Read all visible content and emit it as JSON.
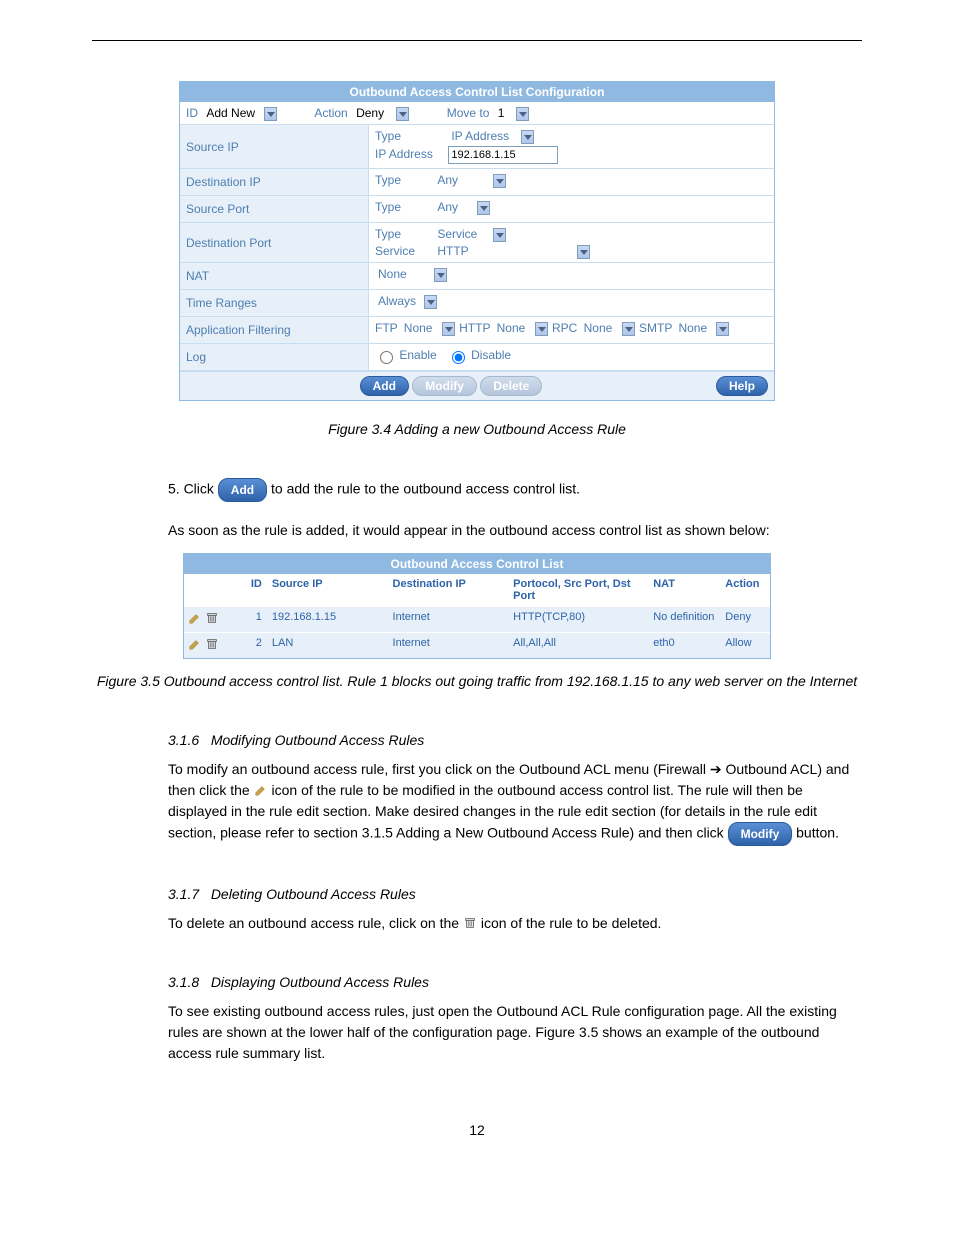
{
  "config_panel": {
    "title": "Outbound Access Control List Configuration",
    "id_label": "ID",
    "id_value": "Add New",
    "action_label": "Action",
    "action_value": "Deny",
    "moveto_label": "Move to",
    "moveto_value": "1",
    "rows": {
      "source_ip": {
        "label": "Source IP",
        "type_label": "Type",
        "type_value": "IP Address",
        "ip_label": "IP Address",
        "ip_value": "192.168.1.15"
      },
      "destination_ip": {
        "label": "Destination IP",
        "type_label": "Type",
        "type_value": "Any"
      },
      "source_port": {
        "label": "Source Port",
        "type_label": "Type",
        "type_value": "Any"
      },
      "destination_port": {
        "label": "Destination Port",
        "type_label": "Type",
        "type_value": "Service",
        "service_label": "Service",
        "service_value": "HTTP"
      },
      "nat": {
        "label": "NAT",
        "value": "None"
      },
      "time_ranges": {
        "label": "Time Ranges",
        "value": "Always"
      },
      "app_filtering": {
        "label": "Application Filtering",
        "ftp": "FTP",
        "ftp_value": "None",
        "http": "HTTP",
        "http_value": "None",
        "rpc": "RPC",
        "rpc_value": "None",
        "smtp": "SMTP",
        "smtp_value": "None"
      },
      "log": {
        "label": "Log",
        "enable": "Enable",
        "disable": "Disable"
      }
    },
    "buttons": {
      "add": "Add",
      "modify": "Modify",
      "delete": "Delete",
      "help": "Help"
    }
  },
  "prose": {
    "fig1": "Figure 3.4 Adding a new Outbound Access Rule",
    "step5_a": "5.   Click ",
    "step5_b": " to add the rule to the outbound access control list.",
    "post_add": "As soon as the rule is added, it would appear in the outbound access control list as shown below:",
    "fig2": "Figure 3.5 Outbound access control list. Rule 1 blocks out going traffic from 192.168.1.15 to any web server on the Internet",
    "sec_num1": "3.1.6",
    "sec_title1": "Modifying Outbound Access Rules",
    "mod_p1_a": "To modify an outbound access rule, first you click on the Outbound ACL menu (Firewall ",
    "mod_p1_b": " Outbound ACL) and then click the ",
    "mod_p1_c": " icon of the rule to be modified in the outbound access control list. The rule will then be displayed in the rule edit section. Make desired changes in the rule edit section (for details in the rule edit section, please refer to section ",
    "mod_p1_d": "3.1.5",
    "mod_p1_e": " Adding a New Outbound Access Rule) and then click ",
    "mod_p1_f": " button.",
    "sec_num2": "3.1.7",
    "sec_title2": "Deleting Outbound Access Rules",
    "del_p_a": "To delete an outbound access rule, click on the ",
    "del_p_b": " icon of the rule to be deleted.",
    "sec_num3": "3.1.8",
    "sec_title3": "Displaying Outbound Access Rules",
    "disp_p": "To see existing outbound access rules, just open the Outbound ACL Rule configuration page. All the existing rules are shown at the lower half of the configuration page. Figure 3.5 shows an example of the outbound access rule summary list.",
    "page_footer": "12"
  },
  "list_panel": {
    "title": "Outbound Access Control List",
    "headers": {
      "id": "ID",
      "src": "Source IP",
      "dst": "Destination IP",
      "prot": "Portocol, Src Port, Dst Port",
      "nat": "NAT",
      "action": "Action"
    },
    "rows": [
      {
        "id": "1",
        "src": "192.168.1.15",
        "dst": "Internet",
        "prot": "HTTP(TCP,80)",
        "nat": "No definition",
        "action": "Deny"
      },
      {
        "id": "2",
        "src": "LAN",
        "dst": "Internet",
        "prot": "All,All,All",
        "nat": "eth0",
        "action": "Allow"
      }
    ]
  },
  "buttons_inline": {
    "add": "Add",
    "modify": "Modify"
  }
}
